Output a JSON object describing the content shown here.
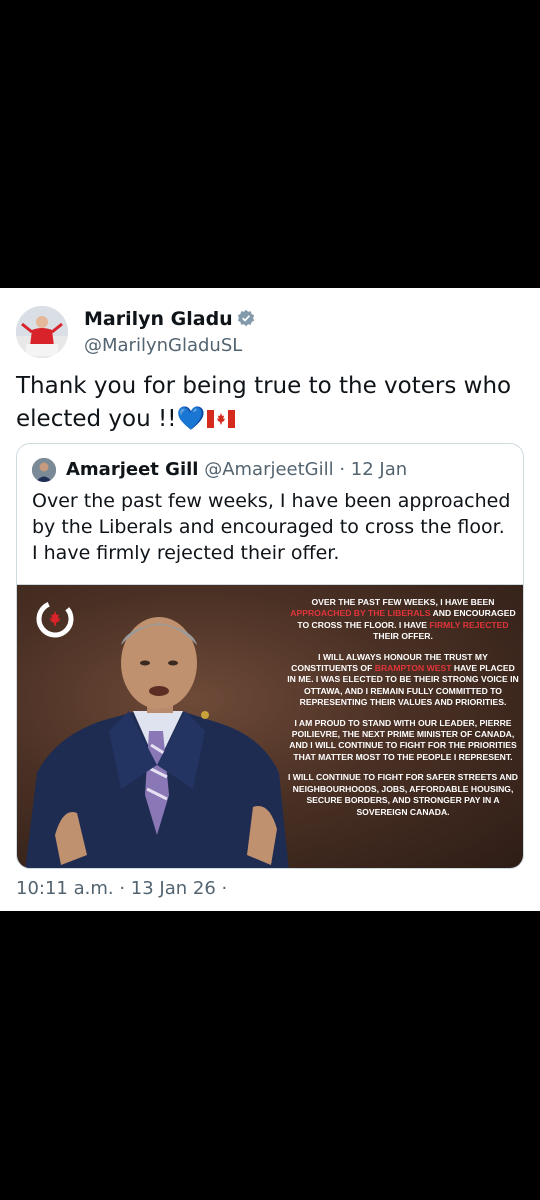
{
  "post": {
    "author_name": "Marilyn Gladu",
    "author_handle": "@MarilynGladuSL",
    "text": "Thank you for being true to the voters who elected you !!",
    "text_emojis": "💙",
    "timestamp": "10:11 a.m. · 13 Jan 26 ·"
  },
  "quote": {
    "author_name": "Amarjeet Gill",
    "author_handle": "@AmarjeetGill",
    "separator": " · ",
    "date": "12 Jan",
    "text": "Over the past few weeks, I have been approached by the Liberals and encouraged to cross the floor. I have firmly rejected their offer."
  },
  "statement": {
    "p1_a": "Over the past few weeks, I have been ",
    "p1_red1": "approached by the Liberals",
    "p1_b": " and encouraged to cross the floor. I have ",
    "p1_red2": "firmly rejected",
    "p1_c": " their offer.",
    "p2_a": "I will always honour the trust my constituents of ",
    "p2_red": "Brampton West",
    "p2_b": " have placed in me. I was elected to be their strong voice in Ottawa, and I remain fully committed to representing their values and priorities.",
    "p3": "I am proud to stand with our leader, Pierre Poilievre, the next Prime Minister of Canada, and I will continue to fight for the priorities that matter most to the people I represent.",
    "p4": "I will continue to fight for safer streets and neighbourhoods, jobs, affordable housing, secure borders, and stronger pay in a sovereign Canada."
  },
  "colors": {
    "verified_badge": "#829aab",
    "statement_red": "#e0343a",
    "muted_text": "#536471"
  }
}
